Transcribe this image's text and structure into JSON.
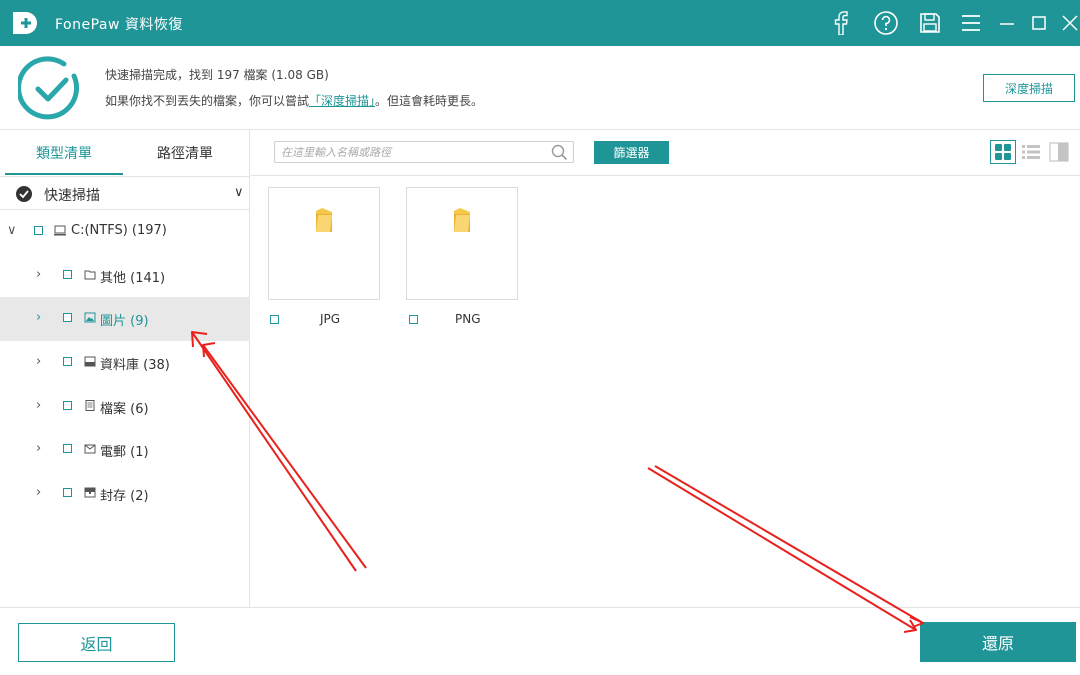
{
  "app": {
    "title": "FonePaw 資料恢復"
  },
  "titlebar_icons": [
    "facebook-icon",
    "help-icon",
    "save-icon",
    "menu-icon",
    "minimize-icon",
    "maximize-icon",
    "close-icon"
  ],
  "status": {
    "line1": "快速掃描完成，找到 197 檔案 (1.08 GB)",
    "line2_prefix": "如果你找不到丟失的檔案，你可以嘗試",
    "line2_link": "「深度掃描」",
    "line2_suffix": "。但這會耗時更長。",
    "deep_scan_button": "深度掃描"
  },
  "sidebar": {
    "tabs": [
      {
        "label": "類型清單",
        "active": true
      },
      {
        "label": "路徑清單",
        "active": false
      }
    ],
    "scan_mode": "快速掃描",
    "scan_chevron": "∨",
    "tree": [
      {
        "label": "C:(NTFS) (197)",
        "arrow": "∨",
        "icon": "drive-icon",
        "selected": false,
        "level": 0
      },
      {
        "label": "其他 (141)",
        "arrow": "›",
        "icon": "folder-icon",
        "selected": false,
        "level": 1
      },
      {
        "label": "圖片 (9)",
        "arrow": "›",
        "icon": "image-icon",
        "selected": true,
        "level": 1
      },
      {
        "label": "資料庫 (38)",
        "arrow": "›",
        "icon": "database-icon",
        "selected": false,
        "level": 1
      },
      {
        "label": "檔案 (6)",
        "arrow": "›",
        "icon": "document-icon",
        "selected": false,
        "level": 1
      },
      {
        "label": "電郵 (1)",
        "arrow": "›",
        "icon": "email-icon",
        "selected": false,
        "level": 1
      },
      {
        "label": "封存 (2)",
        "arrow": "›",
        "icon": "archive-icon",
        "selected": false,
        "level": 1
      }
    ]
  },
  "toolbar": {
    "search_placeholder": "在這里輸入名稱或路徑",
    "filter_button": "篩選器",
    "view_modes": [
      "grid-view",
      "list-view",
      "detail-view"
    ],
    "active_view": "grid-view"
  },
  "files": [
    {
      "name": "JPG",
      "icon": "folder-icon"
    },
    {
      "name": "PNG",
      "icon": "folder-icon"
    }
  ],
  "footer": {
    "back_button": "返回",
    "recover_button": "還原"
  },
  "colors": {
    "accent": "#1f9598",
    "selected_row": "#e8e8e8",
    "folder": "#f5c84c",
    "annotation_arrow": "#e8211d"
  }
}
